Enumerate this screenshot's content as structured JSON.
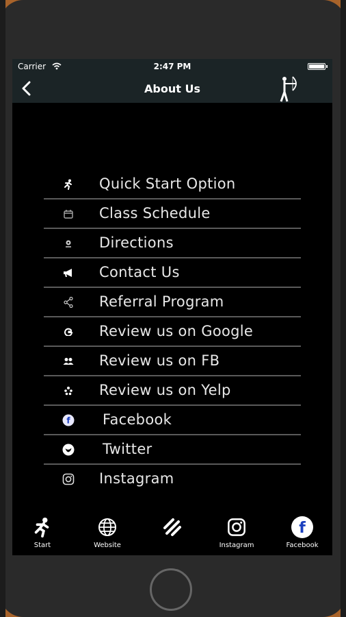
{
  "status": {
    "carrier": "Carrier",
    "time": "2:47 PM"
  },
  "nav": {
    "title": "About Us",
    "back_icon": "chevron-left-icon",
    "logo_icon": "archer-icon"
  },
  "menu": [
    {
      "label": "Quick Start Option",
      "icon": "running-icon"
    },
    {
      "label": "Class Schedule",
      "icon": "calendar-icon"
    },
    {
      "label": "Directions",
      "icon": "map-pin-icon"
    },
    {
      "label": "Contact Us",
      "icon": "megaphone-icon"
    },
    {
      "label": "Referral Program",
      "icon": "share-icon"
    },
    {
      "label": "Review us on Google",
      "icon": "google-icon"
    },
    {
      "label": "Review us on FB",
      "icon": "users-icon"
    },
    {
      "label": "Review us on Yelp",
      "icon": "yelp-icon"
    },
    {
      "label": "Facebook",
      "icon": "facebook-icon"
    },
    {
      "label": "Twitter",
      "icon": "twitter-icon"
    },
    {
      "label": "Instagram",
      "icon": "instagram-icon"
    }
  ],
  "tabs": [
    {
      "label": "Start",
      "icon": "running-icon"
    },
    {
      "label": "Website",
      "icon": "globe-icon"
    },
    {
      "label": "",
      "icon": "menu-lines-icon"
    },
    {
      "label": "Instagram",
      "icon": "instagram-icon"
    },
    {
      "label": "Facebook",
      "icon": "facebook-icon"
    }
  ],
  "colors": {
    "bar_background": "#1b2426",
    "screen_background": "#000000",
    "divider": "#5a5a5a",
    "phone_body": "#2a2a2a"
  }
}
